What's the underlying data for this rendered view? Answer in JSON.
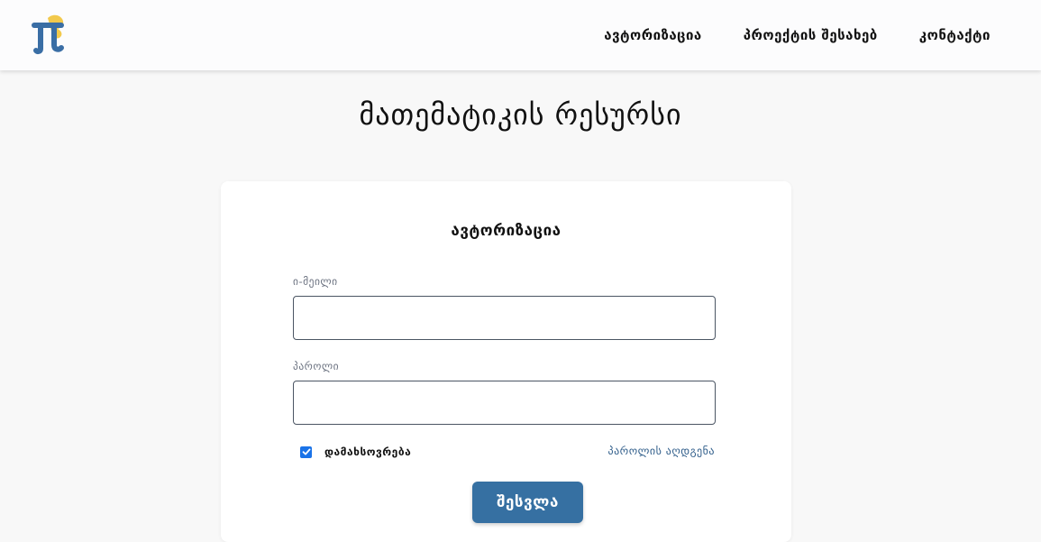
{
  "colors": {
    "page_background": "#f8f8f8",
    "navbar_background": "#fcfcfd",
    "card_background": "#ffffff",
    "primary_button": "#3670a2",
    "link": "#2f5d8a",
    "checkbox": "#1a73e8",
    "logo_blue": "#3a6ea5",
    "logo_yellow": "#f2c94c"
  },
  "navbar": {
    "logo_icon": "pi-logo-icon",
    "links": [
      {
        "label": "ავტორიზაცია"
      },
      {
        "label": "პროექტის შესახებ"
      },
      {
        "label": "კონტაქტი"
      }
    ]
  },
  "page": {
    "title": "მათემატიკის რესურსი"
  },
  "login_form": {
    "title": "ავტორიზაცია",
    "email": {
      "label": "ი-მეილი",
      "value": "",
      "placeholder": ""
    },
    "password": {
      "label": "პაროლი",
      "value": "",
      "placeholder": ""
    },
    "remember_me": {
      "label": "დამახსოვრება",
      "checked": true,
      "icon": "checkmark-icon"
    },
    "forgot_password_label": "პაროლის აღდგენა",
    "submit_label": "შესვლა"
  }
}
